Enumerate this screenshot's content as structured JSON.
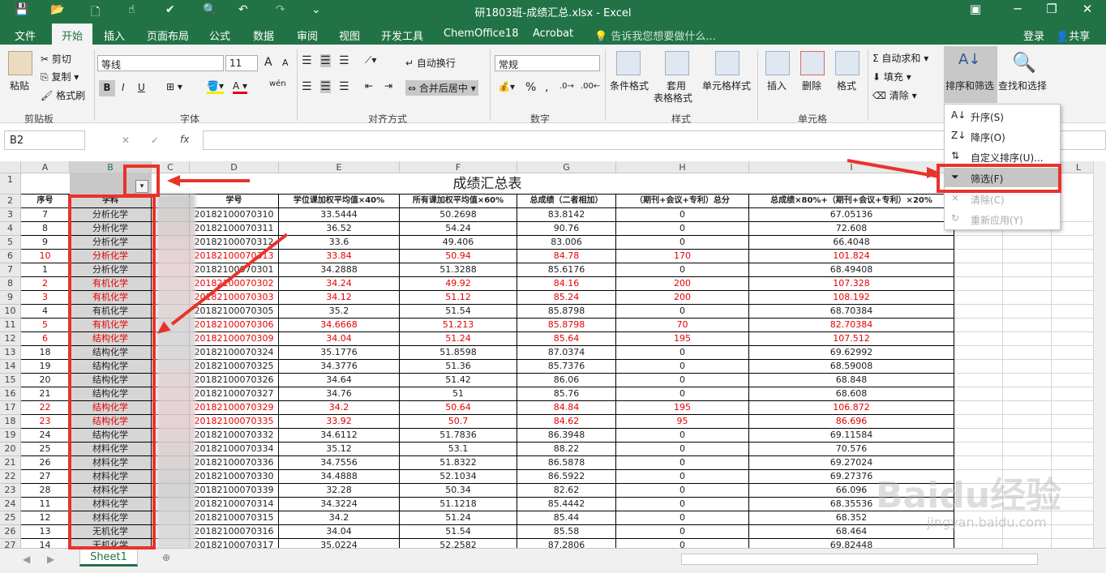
{
  "window": {
    "title": "研1803班-成绩汇总.xlsx - Excel",
    "account": "登录",
    "share": "共享",
    "tell_me": "告诉我您想要做什么..."
  },
  "tabs": [
    "文件",
    "开始",
    "插入",
    "页面布局",
    "公式",
    "数据",
    "审阅",
    "视图",
    "开发工具",
    "ChemOffice18",
    "Acrobat"
  ],
  "ribbon": {
    "clipboard": {
      "paste": "粘贴",
      "cut": "剪切",
      "copy": "复制",
      "format_painter": "格式刷",
      "group": "剪贴板"
    },
    "font": {
      "name": "等线",
      "size": "11",
      "group": "字体",
      "bold": "B",
      "italic": "I",
      "underline": "U",
      "grow": "A",
      "shrink": "A",
      "wen": "wén"
    },
    "alignment": {
      "wrap": "自动换行",
      "merge": "合并后居中",
      "group": "对齐方式"
    },
    "number": {
      "format": "常规",
      "group": "数字",
      "percent": "%",
      "comma": ","
    },
    "styles": {
      "conditional": "条件格式",
      "table_line1": "套用",
      "table_line2": "表格格式",
      "cell_styles": "单元格样式",
      "group": "样式"
    },
    "cells": {
      "insert": "插入",
      "delete": "删除",
      "format": "格式",
      "group": "单元格"
    },
    "editing": {
      "autosum": "自动求和",
      "fill": "填充",
      "clear": "清除",
      "sort_filter": "排序和筛选",
      "find_select": "查找和选择"
    }
  },
  "formula_bar": {
    "name_box": "B2",
    "fx": "fx",
    "cancel": "✕",
    "enter": "✓"
  },
  "columns": [
    "A",
    "B",
    "C",
    "D",
    "E",
    "F",
    "G",
    "H",
    "I",
    "J",
    "K",
    "L"
  ],
  "sheet_title": "成绩汇总表",
  "headers": [
    "序号",
    "学科",
    "",
    "学号",
    "学位课加权平均值×40%",
    "所有课加权平均值×60%",
    "总成绩（二者相加）",
    "（期刊+会议+专利）总分",
    "总成绩×80%+（期刊+会议+专利）×20%"
  ],
  "rows": [
    {
      "n": "3",
      "a": "7",
      "b": "分析化学",
      "d": "20182100070310",
      "e": "33.5444",
      "f": "50.2698",
      "g": "83.8142",
      "h": "0",
      "i": "67.05136",
      "red": false
    },
    {
      "n": "4",
      "a": "8",
      "b": "分析化学",
      "d": "20182100070311",
      "e": "36.52",
      "f": "54.24",
      "g": "90.76",
      "h": "0",
      "i": "72.608",
      "red": false
    },
    {
      "n": "5",
      "a": "9",
      "b": "分析化学",
      "d": "20182100070312",
      "e": "33.6",
      "f": "49.406",
      "g": "83.006",
      "h": "0",
      "i": "66.4048",
      "red": false
    },
    {
      "n": "6",
      "a": "10",
      "b": "分析化学",
      "d": "20182100070313",
      "e": "33.84",
      "f": "50.94",
      "g": "84.78",
      "h": "170",
      "i": "101.824",
      "red": true
    },
    {
      "n": "7",
      "a": "1",
      "b": "分析化学",
      "d": "20182100070301",
      "e": "34.2888",
      "f": "51.3288",
      "g": "85.6176",
      "h": "0",
      "i": "68.49408",
      "red": false
    },
    {
      "n": "8",
      "a": "2",
      "b": "有机化学",
      "d": "20182100070302",
      "e": "34.24",
      "f": "49.92",
      "g": "84.16",
      "h": "200",
      "i": "107.328",
      "red": true
    },
    {
      "n": "9",
      "a": "3",
      "b": "有机化学",
      "d": "20182100070303",
      "e": "34.12",
      "f": "51.12",
      "g": "85.24",
      "h": "200",
      "i": "108.192",
      "red": true
    },
    {
      "n": "10",
      "a": "4",
      "b": "有机化学",
      "d": "20182100070305",
      "e": "35.2",
      "f": "51.54",
      "g": "85.8798",
      "h": "0",
      "i": "68.70384",
      "red": false
    },
    {
      "n": "11",
      "a": "5",
      "b": "有机化学",
      "d": "20182100070306",
      "e": "34.6668",
      "f": "51.213",
      "g": "85.8798",
      "h": "70",
      "i": "82.70384",
      "red": true
    },
    {
      "n": "12",
      "a": "6",
      "b": "结构化学",
      "d": "20182100070309",
      "e": "34.04",
      "f": "51.24",
      "g": "85.64",
      "h": "195",
      "i": "107.512",
      "red": true
    },
    {
      "n": "13",
      "a": "18",
      "b": "结构化学",
      "d": "20182100070324",
      "e": "35.1776",
      "f": "51.8598",
      "g": "87.0374",
      "h": "0",
      "i": "69.62992",
      "red": false
    },
    {
      "n": "14",
      "a": "19",
      "b": "结构化学",
      "d": "20182100070325",
      "e": "34.3776",
      "f": "51.36",
      "g": "85.7376",
      "h": "0",
      "i": "68.59008",
      "red": false
    },
    {
      "n": "15",
      "a": "20",
      "b": "结构化学",
      "d": "20182100070326",
      "e": "34.64",
      "f": "51.42",
      "g": "86.06",
      "h": "0",
      "i": "68.848",
      "red": false
    },
    {
      "n": "16",
      "a": "21",
      "b": "结构化学",
      "d": "20182100070327",
      "e": "34.76",
      "f": "51",
      "g": "85.76",
      "h": "0",
      "i": "68.608",
      "red": false
    },
    {
      "n": "17",
      "a": "22",
      "b": "结构化学",
      "d": "20182100070329",
      "e": "34.2",
      "f": "50.64",
      "g": "84.84",
      "h": "195",
      "i": "106.872",
      "red": true
    },
    {
      "n": "18",
      "a": "23",
      "b": "结构化学",
      "d": "20182100070335",
      "e": "33.92",
      "f": "50.7",
      "g": "84.62",
      "h": "95",
      "i": "86.696",
      "red": true
    },
    {
      "n": "19",
      "a": "24",
      "b": "结构化学",
      "d": "20182100070332",
      "e": "34.6112",
      "f": "51.7836",
      "g": "86.3948",
      "h": "0",
      "i": "69.11584",
      "red": false
    },
    {
      "n": "20",
      "a": "25",
      "b": "材料化学",
      "d": "20182100070334",
      "e": "35.12",
      "f": "53.1",
      "g": "88.22",
      "h": "0",
      "i": "70.576",
      "red": false
    },
    {
      "n": "21",
      "a": "26",
      "b": "材料化学",
      "d": "20182100070336",
      "e": "34.7556",
      "f": "51.8322",
      "g": "86.5878",
      "h": "0",
      "i": "69.27024",
      "red": false
    },
    {
      "n": "22",
      "a": "27",
      "b": "材料化学",
      "d": "20182100070330",
      "e": "34.4888",
      "f": "52.1034",
      "g": "86.5922",
      "h": "0",
      "i": "69.27376",
      "red": false
    },
    {
      "n": "23",
      "a": "28",
      "b": "材料化学",
      "d": "20182100070339",
      "e": "32.28",
      "f": "50.34",
      "g": "82.62",
      "h": "0",
      "i": "66.096",
      "red": false
    },
    {
      "n": "24",
      "a": "11",
      "b": "材料化学",
      "d": "20182100070314",
      "e": "34.3224",
      "f": "51.1218",
      "g": "85.4442",
      "h": "0",
      "i": "68.35536",
      "red": false
    },
    {
      "n": "25",
      "a": "12",
      "b": "材料化学",
      "d": "20182100070315",
      "e": "34.2",
      "f": "51.24",
      "g": "85.44",
      "h": "0",
      "i": "68.352",
      "red": false
    },
    {
      "n": "26",
      "a": "13",
      "b": "无机化学",
      "d": "20182100070316",
      "e": "34.04",
      "f": "51.54",
      "g": "85.58",
      "h": "0",
      "i": "68.464",
      "red": false
    },
    {
      "n": "27",
      "a": "14",
      "b": "无机化学",
      "d": "20182100070317",
      "e": "35.0224",
      "f": "52.2582",
      "g": "87.2806",
      "h": "0",
      "i": "69.82448",
      "red": false
    }
  ],
  "sort_menu": [
    "升序(S)",
    "降序(O)",
    "自定义排序(U)...",
    "筛选(F)",
    "清除(C)",
    "重新应用(Y)"
  ],
  "sheet_tab": "Sheet1",
  "watermark": {
    "main": "Baidu经验",
    "sub": "jingyan.baidu.com"
  },
  "colors": {
    "excel_green": "#217346",
    "highlight_red": "#e8332a",
    "data_red": "#e60000"
  }
}
